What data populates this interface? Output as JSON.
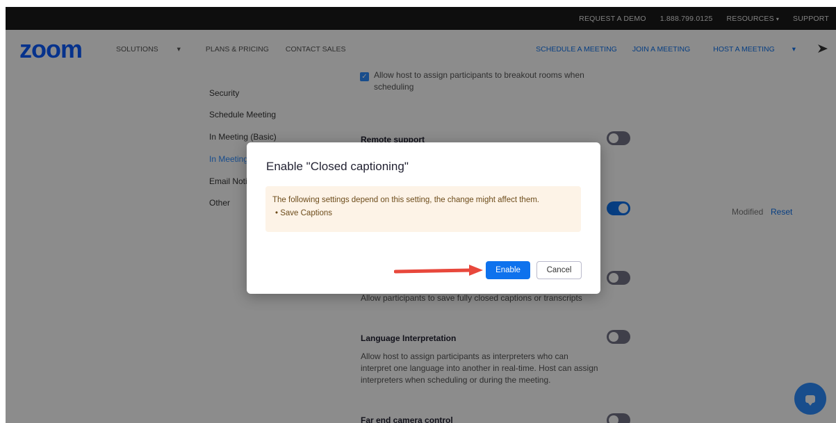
{
  "topbar": {
    "request_demo": "REQUEST A DEMO",
    "phone": "1.888.799.0125",
    "resources": "RESOURCES",
    "support": "SUPPORT"
  },
  "nav": {
    "logo": "zoom",
    "solutions": "SOLUTIONS",
    "plans": "PLANS & PRICING",
    "contact": "CONTACT SALES",
    "schedule": "SCHEDULE A MEETING",
    "join": "JOIN A MEETING",
    "host": "HOST A MEETING"
  },
  "sidebar": {
    "items": [
      "Security",
      "Schedule Meeting",
      "In Meeting (Basic)",
      "In Meeting",
      "Email Noti",
      "Other"
    ]
  },
  "settings": {
    "breakout_desc_line1": "Allow host to assign participants to breakout rooms when",
    "breakout_desc_line2": "scheduling",
    "remote_support_title": "Remote support",
    "save_captions_desc": "Allow participants to save fully closed captions or transcripts",
    "lang_title": "Language Interpretation",
    "lang_desc_line1": "Allow host to assign participants as interpreters who can",
    "lang_desc_line2": "interpret one language into another in real-time. Host can assign",
    "lang_desc_line3": "interpreters when scheduling or during the meeting.",
    "far_end_title": "Far end camera control",
    "modified": "Modified",
    "reset": "Reset"
  },
  "modal": {
    "title": "Enable \"Closed captioning\"",
    "warning": "The following settings depend on this setting, the change might affect them.",
    "affected_item": "• Save Captions",
    "enable_label": "Enable",
    "cancel_label": "Cancel"
  },
  "colors": {
    "brand": "#0b5cff",
    "primary": "#0e72ed",
    "arrow": "#e8483c"
  },
  "icons": {
    "caret": "▾",
    "check": "✓"
  }
}
